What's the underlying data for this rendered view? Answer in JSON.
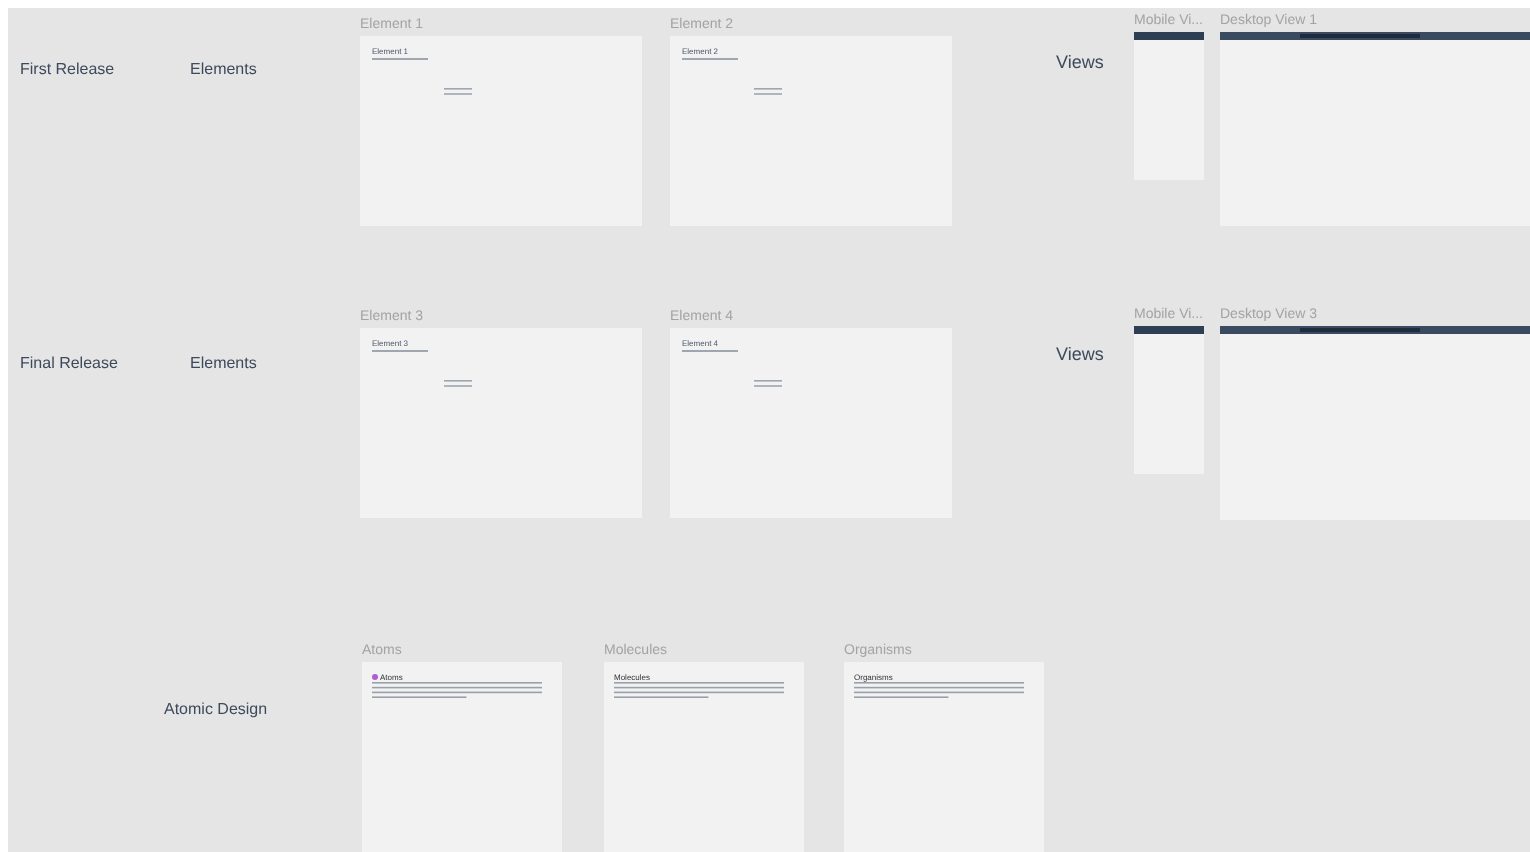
{
  "row_labels": [
    "First Release",
    "Final Release",
    "Atomic Design"
  ],
  "group_labels": [
    "Elements",
    "Elements",
    "Views",
    "Views"
  ],
  "frames": [
    {
      "kind": "element",
      "label": "Element 1",
      "heading": "Element 1"
    },
    {
      "kind": "element",
      "label": "Element 2",
      "heading": "Element 2"
    },
    {
      "kind": "mobile",
      "label": "Mobile Vi..."
    },
    {
      "kind": "desktop",
      "label": "Desktop View 1"
    },
    {
      "kind": "element",
      "label": "Element 3",
      "heading": "Element 3"
    },
    {
      "kind": "element",
      "label": "Element 4",
      "heading": "Element 4"
    },
    {
      "kind": "mobile",
      "label": "Mobile Vi..."
    },
    {
      "kind": "desktop",
      "label": "Desktop View 3"
    },
    {
      "kind": "doc",
      "label": "Atoms",
      "heading": "Atoms",
      "color": "#b05cd6"
    },
    {
      "kind": "doc",
      "label": "Molecules",
      "heading": "Molecules"
    },
    {
      "kind": "doc",
      "label": "Organisms",
      "heading": "Organisms"
    }
  ]
}
